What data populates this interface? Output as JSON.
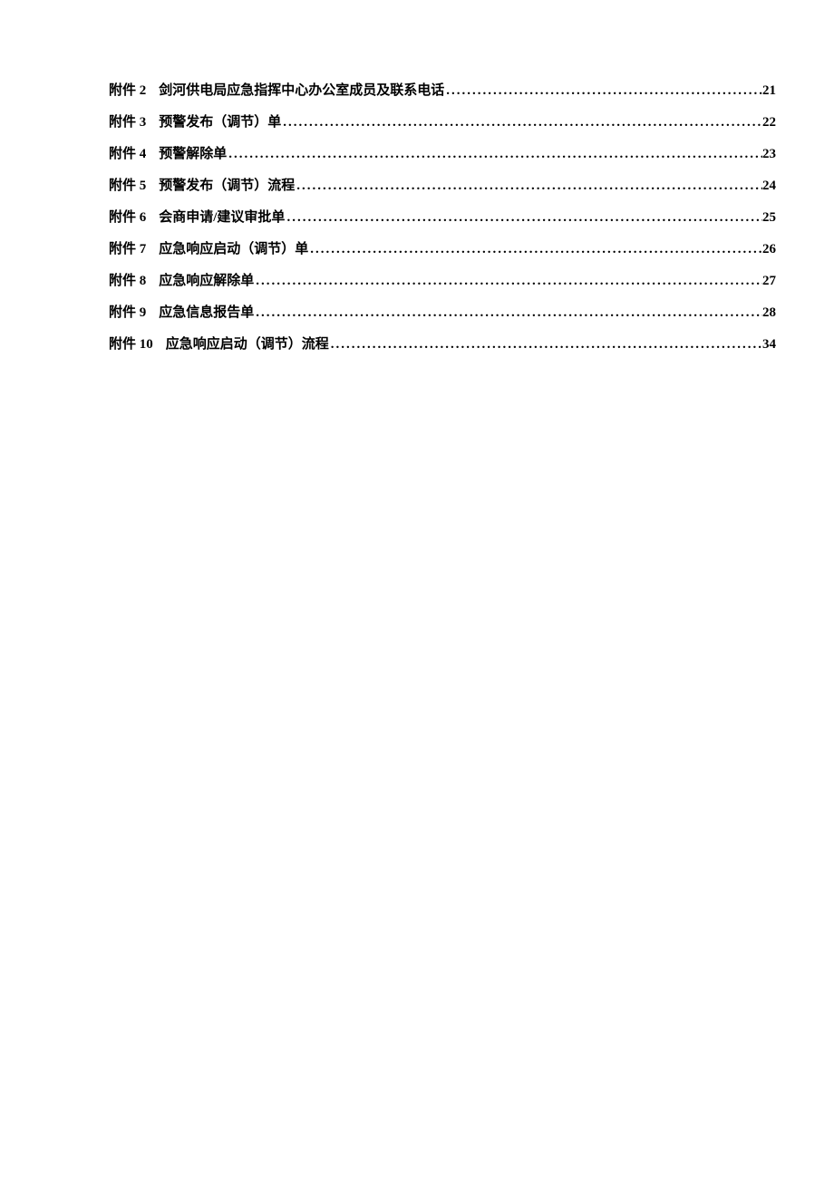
{
  "toc": [
    {
      "label": "附件 2",
      "title": "剑河供电局应急指挥中心办公室成员及联系电话 ",
      "page": "21"
    },
    {
      "label": "附件 3",
      "title": "预警发布（调节）单",
      "page": "22"
    },
    {
      "label": "附件 4",
      "title": "预警解除单",
      "page": "23"
    },
    {
      "label": "附件 5",
      "title": "预警发布（调节）流程",
      "page": "24"
    },
    {
      "label": "附件 6",
      "title": "会商申请/建议审批单",
      "page": "25"
    },
    {
      "label": "附件 7",
      "title": "应急响应启动（调节）单 ",
      "page": "26"
    },
    {
      "label": "附件 8",
      "title": "应急响应解除单",
      "page": "27"
    },
    {
      "label": "附件 9",
      "title": "应急信息报告单",
      "page": "28"
    },
    {
      "label": "附件 10",
      "title": " 应急响应启动（调节）流程 ",
      "page": "34"
    }
  ]
}
